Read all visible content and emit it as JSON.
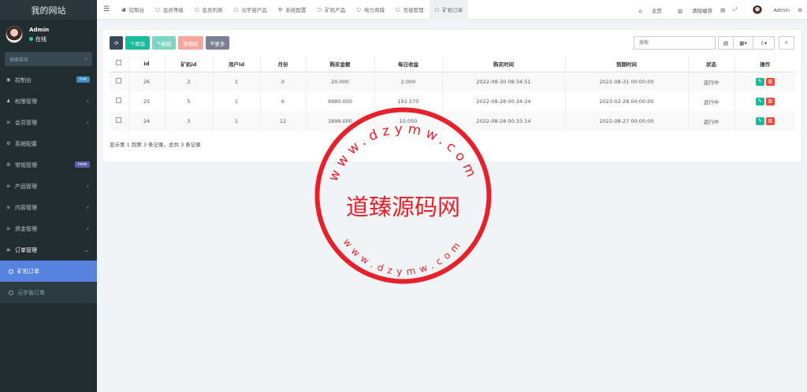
{
  "app": {
    "title": "我的网站"
  },
  "user": {
    "name": "Admin",
    "status": "在线"
  },
  "sidebar": {
    "search_placeholder": "搜索菜单",
    "items": [
      {
        "label": "控制台",
        "badge": "hot",
        "badge_color": "#3c8dbc"
      },
      {
        "label": "权限管理",
        "arrow": "‹"
      },
      {
        "label": "会员管理",
        "arrow": "‹"
      },
      {
        "label": "系统配置"
      },
      {
        "label": "常规管理",
        "badge": "new",
        "badge_color": "#605ca8"
      },
      {
        "label": "产品管理",
        "arrow": "‹"
      },
      {
        "label": "内容管理",
        "arrow": "‹"
      },
      {
        "label": "资金管理",
        "arrow": "‹"
      },
      {
        "label": "订单管理",
        "arrow": "⌄"
      }
    ],
    "sub_items": [
      {
        "label": "矿机订单",
        "active": true
      },
      {
        "label": "元宇宙订单",
        "active": false
      }
    ]
  },
  "tabs": [
    {
      "label": "控制台",
      "icon": "dashboard-icon"
    },
    {
      "label": "会员等级",
      "icon": "circle-icon"
    },
    {
      "label": "会员列表",
      "icon": "circle-icon"
    },
    {
      "label": "元宇宙产品",
      "icon": "circle-icon"
    },
    {
      "label": "系统配置",
      "icon": "gear-icon"
    },
    {
      "label": "矿机产品",
      "icon": "circle-icon"
    },
    {
      "label": "电力商城",
      "icon": "circle-icon"
    },
    {
      "label": "充值管理",
      "icon": "circle-icon"
    },
    {
      "label": "矿机订单",
      "icon": "circle-icon",
      "active": true
    }
  ],
  "header_right": {
    "home": "主页",
    "clear_cache": "清除缓存",
    "admin": "Admin"
  },
  "toolbar": {
    "add": "添加",
    "edit": "编辑",
    "delete": "删除",
    "more": "更多",
    "search_placeholder": "搜索"
  },
  "table": {
    "columns": [
      "Id",
      "矿机id",
      "用户Id",
      "月份",
      "购买金额",
      "每日收益",
      "购买时间",
      "到期时间",
      "状态",
      "操作"
    ],
    "rows": [
      [
        "26",
        "2",
        "1",
        "0",
        "20.000",
        "2.000",
        "2022-08-30 08:34:51",
        "2022-08-31 00:00:00",
        "运行中"
      ],
      [
        "25",
        "5",
        "1",
        "6",
        "9980.000",
        "192.570",
        "2022-08-28 00:34:24",
        "2023-02-28 00:00:00",
        "运行中"
      ],
      [
        "24",
        "3",
        "1",
        "12",
        "1899.000",
        "10.050",
        "2022-08-28 00:33:14",
        "2022-08-27 00:00:00",
        "运行中"
      ]
    ]
  },
  "pager": {
    "text": "显示第 1 到第 3 条记录，总共 3 条记录"
  },
  "watermark": {
    "text": "道臻源码网",
    "ring_text": "www.dzymw.com"
  },
  "colors": {
    "sidebar_bg": "#222d32",
    "active": "#5882e0",
    "add": "#18bc9c",
    "edit": "#7ed6c2",
    "delete": "#f4a79c",
    "more": "#7b7f93",
    "refresh": "#39495a",
    "stamp": "#e8202a"
  }
}
